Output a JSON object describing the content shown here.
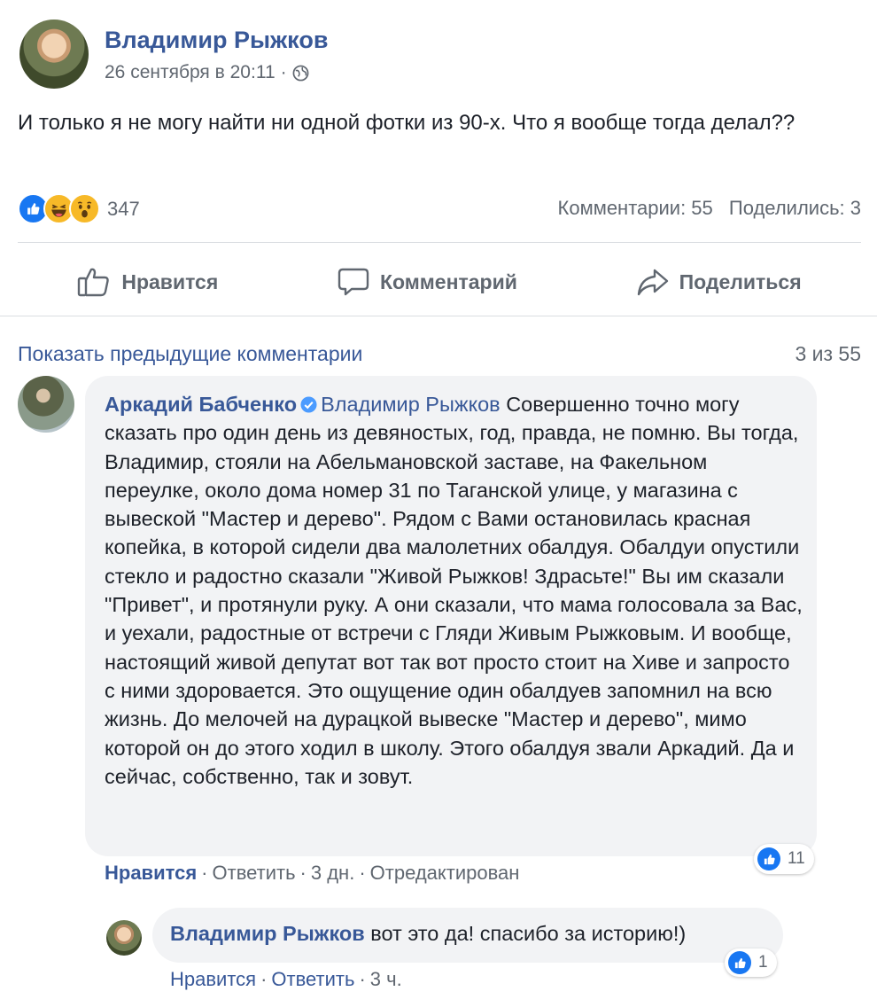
{
  "post": {
    "author": "Владимир Рыжков",
    "timestamp": "26 сентября в 20:11",
    "separator": "·",
    "privacy_icon": "globe-icon",
    "text": "И только я не могу найти ни одной фотки из 90-х. Что я вообще тогда делал??",
    "reactions": {
      "types": [
        "like-icon",
        "haha-icon",
        "wow-icon"
      ],
      "count": "347"
    },
    "comments_count": "Комментарии: 55",
    "shares_count": "Поделились: 3"
  },
  "actions": {
    "like": "Нравится",
    "comment": "Комментарий",
    "share": "Поделиться"
  },
  "comments_section": {
    "show_previous": "Показать предыдущие комментарии",
    "range": "3 из 55"
  },
  "comment1": {
    "author": "Аркадий Бабченко",
    "verified_icon": "verified-badge-icon",
    "tag": "Владимир Рыжков",
    "text": "Совершенно точно могу сказать про один день из девяностых, год, правда, не помню. Вы тогда, Владимир, стояли на Абельмановской заставе, на Факельном переулке, около дома номер 31 по Таганской улице, у магазина с вывеской \"Мастер и дерево\". Рядом с Вами остановилась красная копейка, в которой сидели два малолетних обалдуя. Обалдуи опустили стекло и радостно сказали \"Живой Рыжков! Здрасьте!\" Вы им сказали \"Привет\", и протянули руку. А они сказали, что мама голосовала за Вас, и уехали, радостные от встречи с Гляди Живым Рыжковым. И вообще, настоящий живой депутат вот так вот просто стоит на Хиве и запросто с ними здоровается. Это ощущение один обалдуев запомнил на всю жизнь. До мелочей на дурацкой вывеске \"Мастер и дерево\", мимо которой он до этого ходил в школу. Этого обалдуя звали Аркадий. Да и сейчас, собственно, так и зовут.",
    "like_label": "Нравится",
    "reply_label": "Ответить",
    "age": "3 дн.",
    "edited": "Отредактирован",
    "likes": "11"
  },
  "reply1": {
    "author": "Владимир Рыжков",
    "text": "вот это да! спасибо за историю!)",
    "like_label": "Нравится",
    "reply_label": "Ответить",
    "age": "3 ч.",
    "likes": "1"
  }
}
